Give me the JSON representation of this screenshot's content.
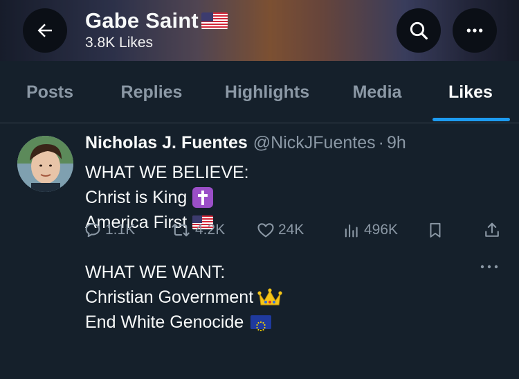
{
  "header": {
    "profile_name": "Gabe Saint",
    "likes_count": "3.8K Likes",
    "back_icon": "arrow-left-icon",
    "search_icon": "search-icon",
    "more_icon": "more-horizontal-icon"
  },
  "tabs": [
    {
      "label": "Posts",
      "active": false
    },
    {
      "label": "Replies",
      "active": false
    },
    {
      "label": "Highlights",
      "active": false
    },
    {
      "label": "Media",
      "active": false
    },
    {
      "label": "Likes",
      "active": true
    }
  ],
  "tweet": {
    "author_name": "Nicholas J. Fuentes",
    "author_handle": "@NickJFuentes",
    "separator": "·",
    "time": "9h",
    "lines": [
      "WHAT WE BELIEVE:",
      "Christ is King",
      "America First",
      "",
      "WHAT WE WANT:",
      "Christian Government",
      "End White Genocide"
    ],
    "stats": {
      "replies": "1.1K",
      "reposts": "4.2K",
      "likes": "24K",
      "views": "496K"
    }
  },
  "colors": {
    "background": "#15202b",
    "accent": "#1d9bf0",
    "muted_text": "#8b98a5",
    "divider": "#38444d"
  }
}
